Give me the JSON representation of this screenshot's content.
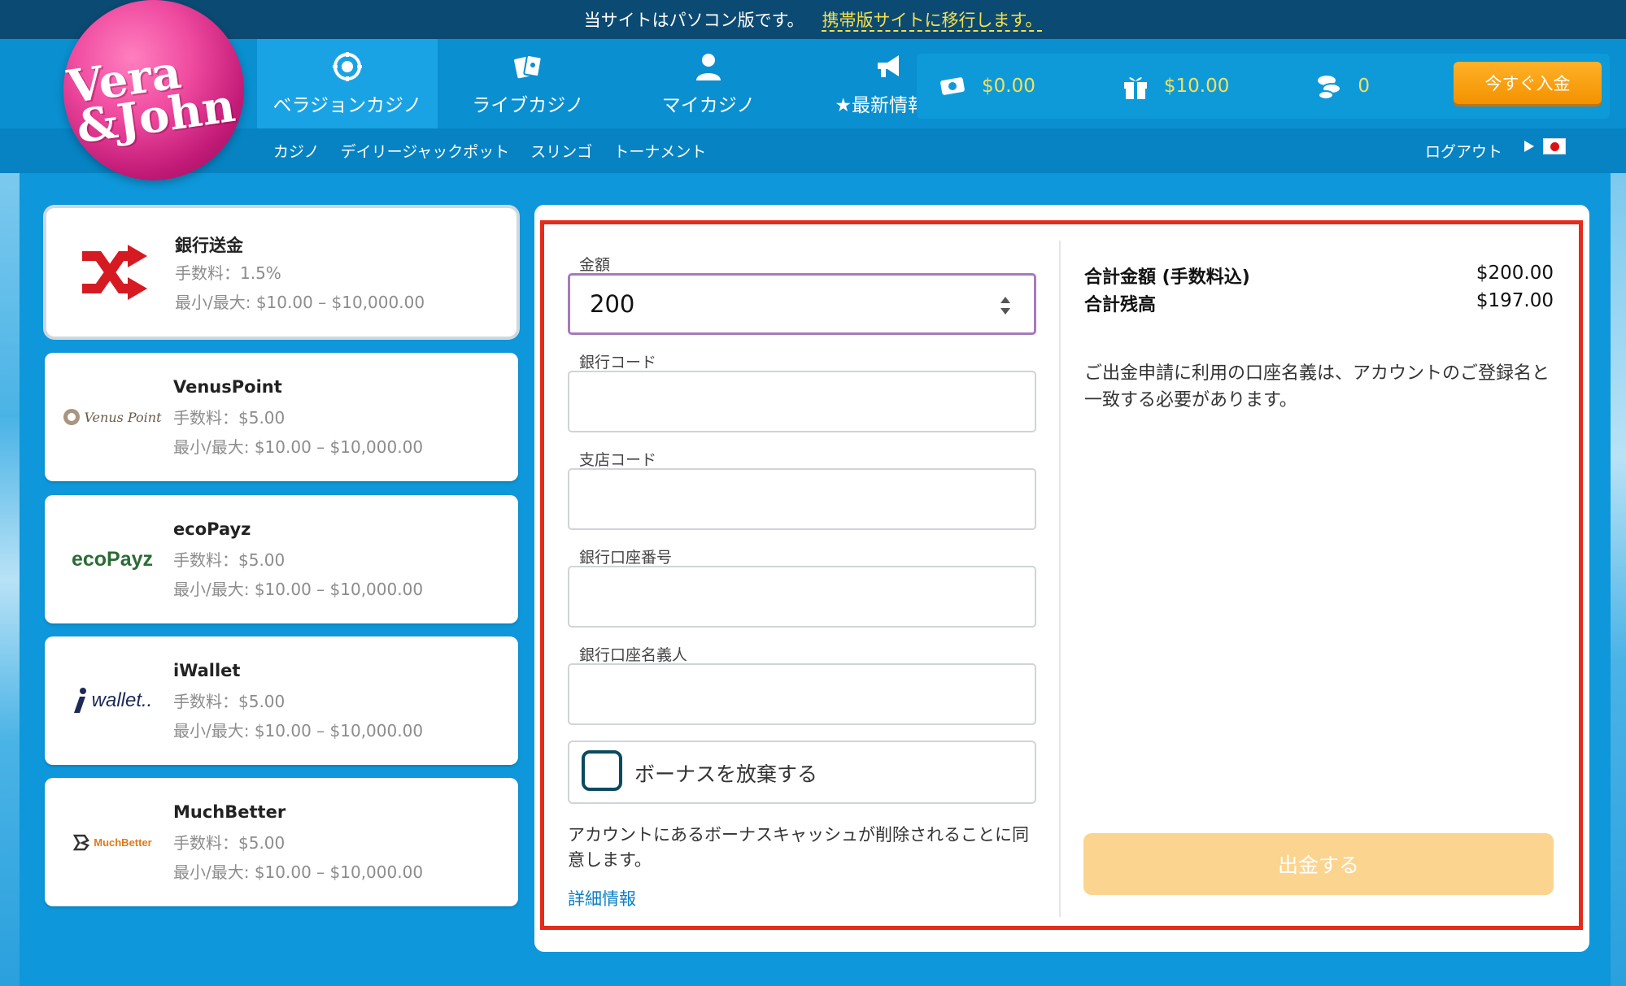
{
  "notice": {
    "text": "当サイトはパソコン版です。",
    "link": "携帯版サイトに移行します。"
  },
  "logo": {
    "line1": "Vera",
    "line2": "&John"
  },
  "nav": {
    "tabs": [
      {
        "label": "ベラジョンカジノ",
        "icon": "chip-icon"
      },
      {
        "label": "ライブカジノ",
        "icon": "cards-icon"
      },
      {
        "label": "マイカジノ",
        "icon": "user-icon"
      },
      {
        "label": "★最新情報★",
        "icon": "megaphone-icon"
      }
    ],
    "sub": [
      "カジノ",
      "デイリージャックポット",
      "スリンゴ",
      "トーナメント"
    ],
    "logout": "ログアウト"
  },
  "wallet": {
    "cash": "$0.00",
    "bonus": "$10.00",
    "points": "0",
    "deposit_label": "今すぐ入金"
  },
  "methods": [
    {
      "name": "銀行送金",
      "fee": "手数料：1.5%",
      "limit": "最小/最大: $10.00 – $10,000.00",
      "logo": "shuffle-icon"
    },
    {
      "name": "VenusPoint",
      "fee": "手数料：$5.00",
      "limit": "最小/最大: $10.00 – $10,000.00",
      "logo": "Venus Point"
    },
    {
      "name": "ecoPayz",
      "fee": "手数料：$5.00",
      "limit": "最小/最大: $10.00 – $10,000.00",
      "logo": "ecoPayz"
    },
    {
      "name": "iWallet",
      "fee": "手数料：$5.00",
      "limit": "最小/最大: $10.00 – $10,000.00",
      "logo": "wallet.."
    },
    {
      "name": "MuchBetter",
      "fee": "手数料：$5.00",
      "limit": "最小/最大: $10.00 – $10,000.00",
      "logo": "MuchBetter"
    }
  ],
  "form": {
    "amount_label": "金額",
    "amount_value": "200",
    "bank_code_label": "銀行コード",
    "branch_code_label": "支店コード",
    "account_number_label": "銀行口座番号",
    "account_holder_label": "銀行口座名義人",
    "bonus_label": "ボーナスを放棄する",
    "consent": "アカウントにあるボーナスキャッシュが削除されることに同意します。",
    "details_link": "詳細情報"
  },
  "summary": {
    "total_label": "合計金額 (手数料込)",
    "total_value": "$200.00",
    "balance_label": "合計残高",
    "balance_value": "$197.00",
    "notice": "ご出金申請に利用の口座名義は、アカウントのご登録名と一致する必要があります。",
    "withdraw_label": "出金する"
  },
  "colors": {
    "accent": "#f39200",
    "frame": "#e52b1c",
    "link": "#0a7fc6"
  }
}
